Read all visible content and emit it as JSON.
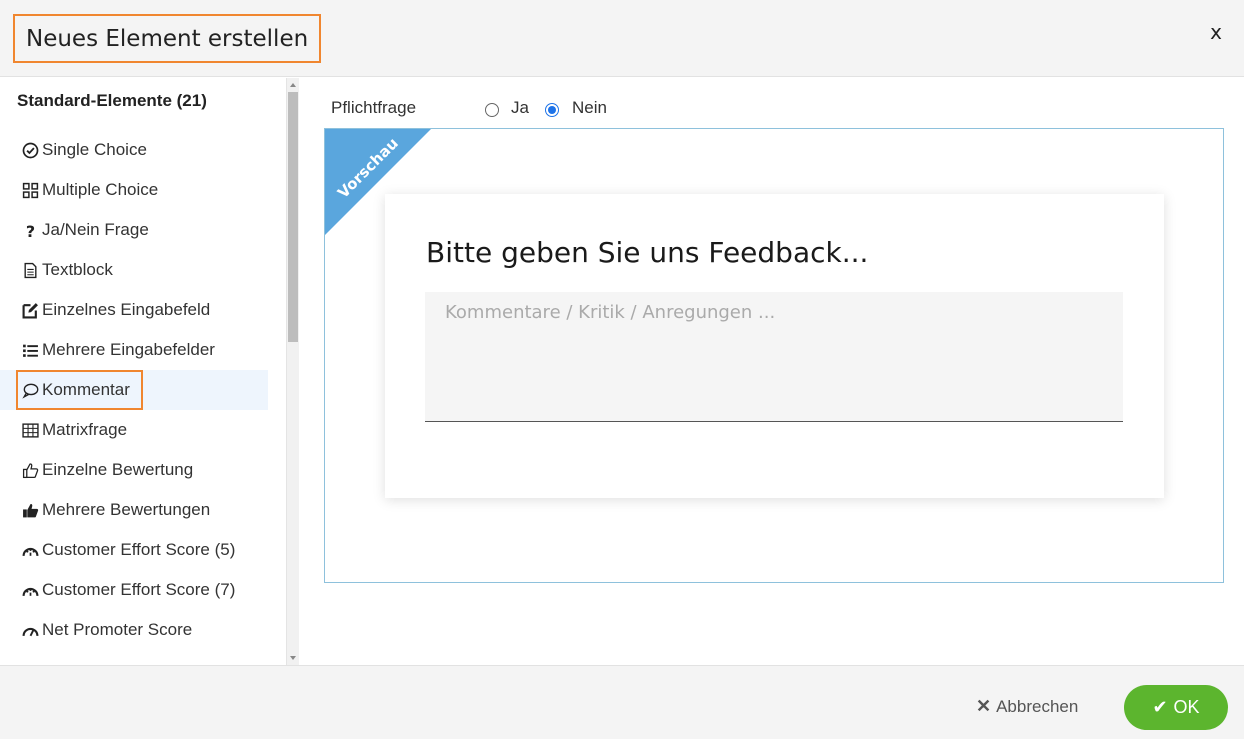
{
  "dialog": {
    "title": "Neues Element erstellen",
    "close_label": "x"
  },
  "sidebar": {
    "section_title": "Standard-Elemente (21)",
    "items": [
      {
        "label": "Single Choice",
        "icon": "check-circle-icon"
      },
      {
        "label": "Multiple Choice",
        "icon": "grid-icon"
      },
      {
        "label": "Ja/Nein Frage",
        "icon": "question-icon"
      },
      {
        "label": "Textblock",
        "icon": "document-icon"
      },
      {
        "label": "Einzelnes Eingabefeld",
        "icon": "edit-icon"
      },
      {
        "label": "Mehrere Eingabefelder",
        "icon": "list-icon"
      },
      {
        "label": "Kommentar",
        "icon": "comment-icon",
        "active": true
      },
      {
        "label": "Matrixfrage",
        "icon": "table-icon"
      },
      {
        "label": "Einzelne Bewertung",
        "icon": "thumbs-up-outline-icon"
      },
      {
        "label": "Mehrere Bewertungen",
        "icon": "thumbs-up-solid-icon"
      },
      {
        "label": "Customer Effort Score (5)",
        "icon": "gauge-icon"
      },
      {
        "label": "Customer Effort Score (7)",
        "icon": "gauge-icon"
      },
      {
        "label": "Net Promoter Score",
        "icon": "speedometer-icon"
      }
    ]
  },
  "main": {
    "required_label": "Pflichtfrage",
    "option_yes": "Ja",
    "option_no": "Nein",
    "selected_option": "Nein",
    "ribbon_label": "Vorschau",
    "preview_question": "Bitte geben Sie uns Feedback...",
    "preview_placeholder": "Kommentare / Kritik / Anregungen ..."
  },
  "footer": {
    "cancel_label": "Abbrechen",
    "ok_label": "OK"
  },
  "colors": {
    "highlight": "#f0862f",
    "ribbon": "#5aa6dd",
    "ok": "#5cb52e",
    "radio": "#1e73e8"
  }
}
